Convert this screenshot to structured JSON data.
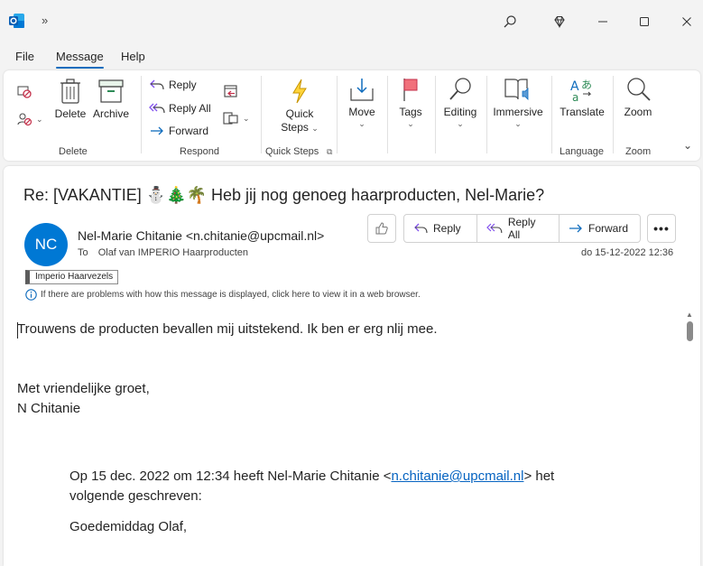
{
  "titlebar": {
    "more_label": "»",
    "icons": [
      "outlook-icon",
      "search-icon",
      "diamond-icon",
      "minimize-icon",
      "maximize-icon",
      "close-icon"
    ]
  },
  "menu": {
    "items": [
      "File",
      "Message",
      "Help"
    ],
    "active": "Message"
  },
  "ribbon": {
    "groups": {
      "delete": "Delete",
      "respond": "Respond",
      "quick_steps": "Quick Steps",
      "language": "Language",
      "zoom": "Zoom"
    },
    "buttons": {
      "delete": "Delete",
      "archive": "Archive",
      "reply": "Reply",
      "reply_all": "Reply All",
      "forward": "Forward",
      "quick_steps_line1": "Quick",
      "quick_steps_line2": "Steps",
      "move": "Move",
      "tags": "Tags",
      "editing": "Editing",
      "immersive": "Immersive",
      "translate": "Translate",
      "zoom": "Zoom"
    }
  },
  "message": {
    "subject": "Re: [VAKANTIE] ⛄🎄🌴 Heb jij nog genoeg haarproducten, Nel-Marie?",
    "avatar_initials": "NC",
    "sender": "Nel-Marie Chitanie <n.chitanie@upcmail.nl>",
    "to_label": "To",
    "to": "Olaf van IMPERIO Haarproducten",
    "date": "do 15-12-2022 12:36",
    "category": "Imperio Haarvezels",
    "info_notice": "If there are problems with how this message is displayed, click here to view it in a web browser.",
    "actions": {
      "reply": "Reply",
      "reply_all": "Reply All",
      "forward": "Forward",
      "more": "•••"
    },
    "body": {
      "line1": "Trouwens de producten bevallen mij uitstekend. Ik ben er erg nlij mee.",
      "greeting": "Met vriendelijke groet,",
      "name": "N Chitanie",
      "quote_prefix": "Op 15 dec. 2022 om 12:34 heeft Nel-Marie Chitanie <",
      "quote_link": "n.chitanie@upcmail.nl",
      "quote_suffix": "> het",
      "quote_line2": "volgende geschreven:",
      "quote_greeting": "Goedemiddag Olaf,"
    }
  },
  "colors": {
    "accent": "#0f6cbd",
    "avatar": "#0078d4",
    "link": "#0563c1"
  }
}
